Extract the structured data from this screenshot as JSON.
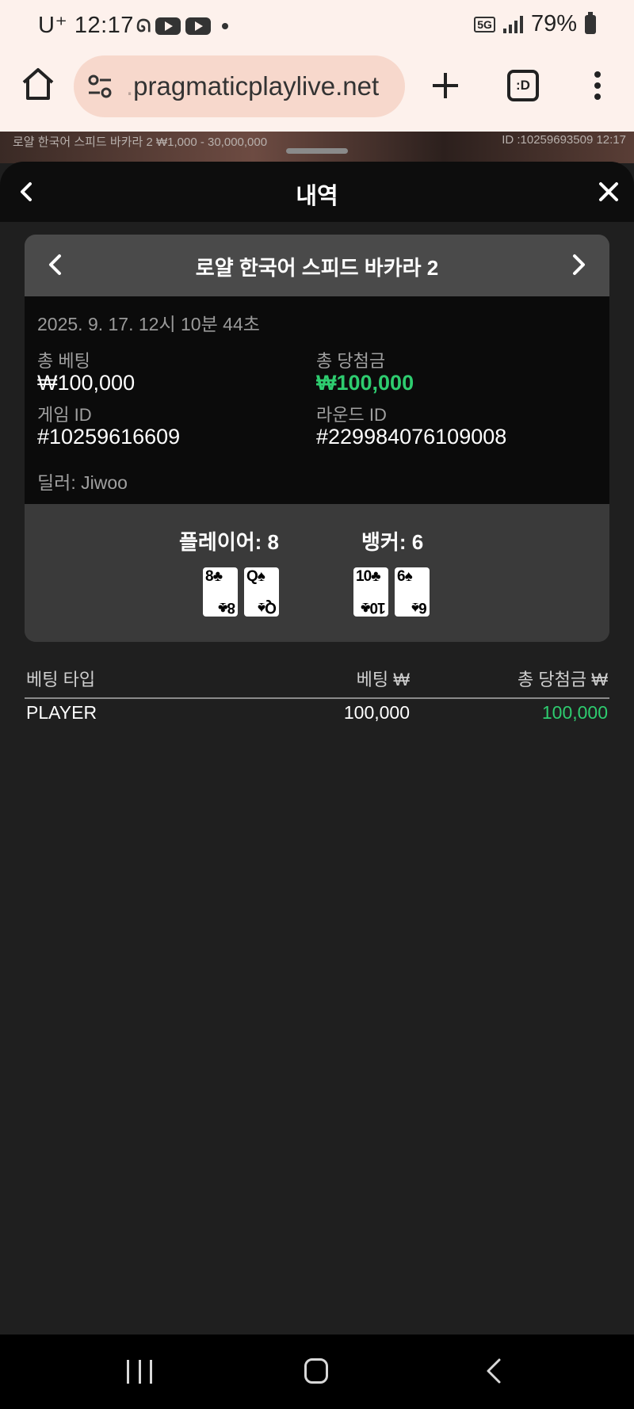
{
  "status_bar": {
    "carrier": "U⁺",
    "time": "12:17",
    "network": "5G",
    "battery": "79%"
  },
  "browser": {
    "url_prefix": ".",
    "url_domain": "pragmaticplaylive.net",
    "tabs_label": ":D"
  },
  "game_strip": {
    "title": "로얄 한국어 스피드 바카라 2 ₩1,000 - 30,000,000",
    "id_time": "ID :10259693509 12:17"
  },
  "sheet": {
    "title": "내역"
  },
  "record": {
    "game_name": "로얄 한국어 스피드 바카라 2",
    "datetime": "2025. 9. 17. 12시 10분 44초",
    "total_bet_label": "총 베팅",
    "total_bet_value": "₩100,000",
    "total_win_label": "총 당첨금",
    "total_win_value": "₩100,000",
    "game_id_label": "게임 ID",
    "game_id_value": "#10259616609",
    "round_id_label": "라운드 ID",
    "round_id_value": "#229984076109008",
    "dealer": "딜러: Jiwoo"
  },
  "result": {
    "player_score": "플레이어: 8",
    "banker_score": "뱅커: 6",
    "player_cards": [
      {
        "rank": "8",
        "suit": "♣"
      },
      {
        "rank": "Q",
        "suit": "♠"
      }
    ],
    "banker_cards": [
      {
        "rank": "10",
        "suit": "♣"
      },
      {
        "rank": "6",
        "suit": "♠"
      }
    ]
  },
  "bets": {
    "headers": {
      "type": "베팅 타입",
      "bet": "베팅 ₩",
      "win": "총 당첨금 ₩"
    },
    "rows": [
      {
        "type": "PLAYER",
        "bet": "100,000",
        "win": "100,000"
      }
    ]
  },
  "colors": {
    "win_green": "#2ecc6f",
    "browser_bg": "#fdf1ec",
    "url_pill": "#f7d8cc"
  }
}
